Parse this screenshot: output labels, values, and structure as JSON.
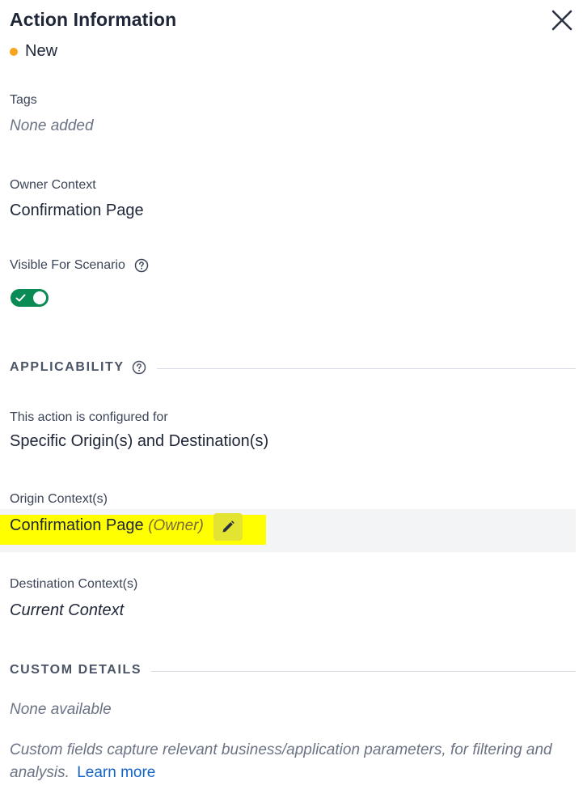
{
  "header": {
    "title": "Action Information",
    "status": "New",
    "status_color": "#f7a51c"
  },
  "tags": {
    "label": "Tags",
    "value": "None added"
  },
  "owner_context": {
    "label": "Owner Context",
    "value": "Confirmation Page"
  },
  "visible_for_scenario": {
    "label": "Visible For Scenario",
    "enabled": true,
    "toggle_color": "#0a8a55"
  },
  "applicability": {
    "heading": "APPLICABILITY",
    "configured_label": "This action is configured for",
    "configured_value": "Specific Origin(s) and Destination(s)",
    "origin_label": "Origin Context(s)",
    "origin_value": "Confirmation Page",
    "origin_owner_tag": "(Owner)",
    "destination_label": "Destination Context(s)",
    "destination_value": "Current Context"
  },
  "custom_details": {
    "heading": "CUSTOM DETAILS",
    "value": "None available",
    "description": "Custom fields capture relevant business/application parameters, for filtering and analysis.",
    "learn_more": "Learn more",
    "link_color": "#1464c8"
  },
  "icons": {
    "close": "close-icon",
    "help": "help-circle-icon",
    "edit": "pencil-icon",
    "check": "check-icon"
  }
}
